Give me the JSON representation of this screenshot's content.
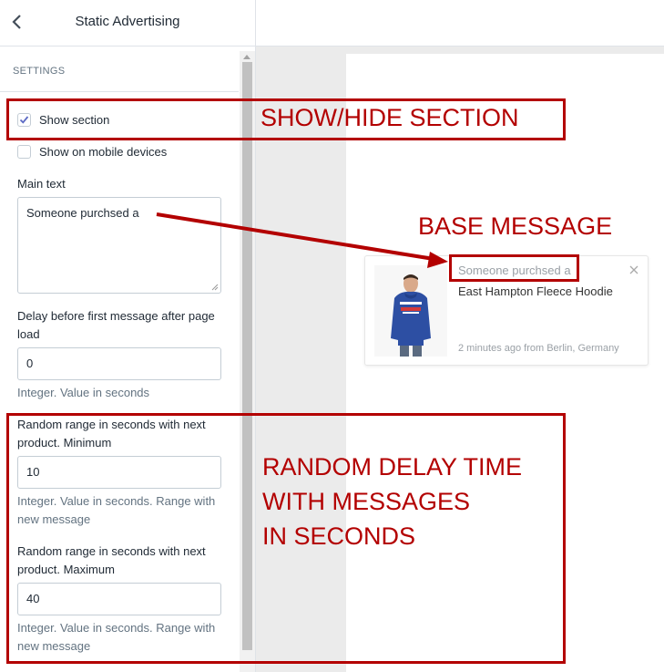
{
  "header": {
    "title": "Static Advertising",
    "back_icon": "chevron-left-icon"
  },
  "settings": {
    "section_label": "SETTINGS",
    "show_section": {
      "label": "Show section",
      "checked": true
    },
    "show_mobile": {
      "label": "Show on mobile devices",
      "checked": false
    },
    "main_text": {
      "label": "Main text",
      "value": "Someone purchsed a"
    },
    "delay_first": {
      "label": "Delay before first message after page load",
      "value": "0",
      "help": "Integer. Value in seconds"
    },
    "range_min": {
      "label": "Random range in seconds with next product. Minimum",
      "value": "10",
      "help": "Integer. Value in seconds. Range with new message"
    },
    "range_max": {
      "label": "Random range in seconds with next product. Maximum",
      "value": "40",
      "help": "Integer. Value in seconds. Range with new message"
    }
  },
  "popup": {
    "base_message": "Someone purchsed a",
    "product_name": "East Hampton Fleece Hoodie",
    "meta": "2 minutes ago from Berlin, Germany",
    "close_icon": "close-icon"
  },
  "annotations": {
    "show_hide": "SHOW/HIDE SECTION",
    "base_message": "BASE MESSAGE",
    "random_line1": "RANDOM DELAY TIME",
    "random_line2": "WITH MESSAGES",
    "random_line3": "IN SECONDS",
    "color": "#b30000"
  }
}
